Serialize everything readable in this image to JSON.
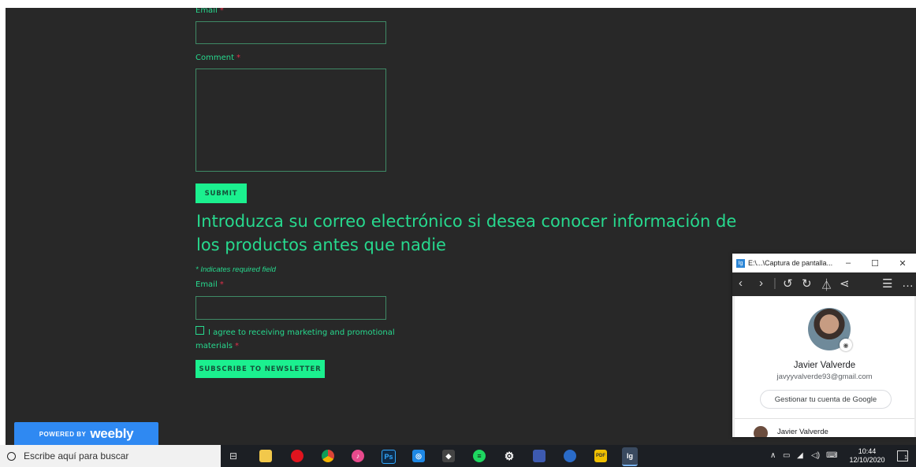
{
  "form": {
    "email_label": "Email",
    "required_mark": "*",
    "comment_label": "Comment",
    "submit_label": "SUBMIT"
  },
  "newsletter": {
    "heading": "Introduzca su correo electrónico si desea conocer información de los productos antes que nadie",
    "required_note": "* Indicates required field",
    "email_label": "Email",
    "agree_text": "I agree to receiving marketing and promotional materials",
    "subscribe_label": "SUBSCRIBE TO NEWSLETTER"
  },
  "weebly": {
    "powered_by": "POWERED BY",
    "brand": "weebly"
  },
  "popup": {
    "title": "E:\\...\\Captura de pantalla...",
    "user_name": "Javier Valverde",
    "user_email": "javyyvalverde93@gmail.com",
    "manage_button": "Gestionar tu cuenta de Google",
    "account_item": "Javier Valverde"
  },
  "taskbar": {
    "search_placeholder": "Escribe aquí para buscar",
    "time": "10:44",
    "date": "12/10/2020",
    "notifications": "1",
    "apps": [
      "task-view",
      "file-explorer",
      "opera",
      "chrome",
      "itunes",
      "photoshop",
      "instagram",
      "inkscape",
      "spotify",
      "settings",
      "app-blue",
      "steam",
      "pdf",
      "image-viewer"
    ]
  },
  "colors": {
    "page_bg": "#282828",
    "accent": "#27d98e",
    "button": "#1bf08f",
    "weebly_blue": "#2f89f2"
  }
}
